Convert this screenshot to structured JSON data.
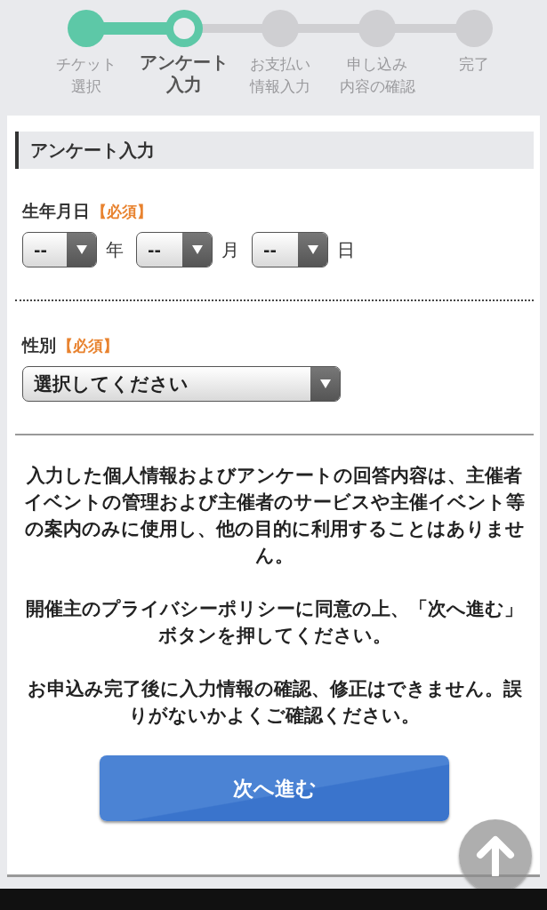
{
  "steps": [
    {
      "label_lines": [
        "チケット",
        "選択"
      ],
      "completed": true,
      "selected": false
    },
    {
      "label_lines": [
        "アンケート",
        "入力"
      ],
      "completed": false,
      "selected": true
    },
    {
      "label_lines": [
        "お支払い",
        "情報入力"
      ],
      "completed": false,
      "selected": false
    },
    {
      "label_lines": [
        "申し込み",
        "内容の確認"
      ],
      "completed": false,
      "selected": false
    },
    {
      "label_lines": [
        "完了"
      ],
      "completed": false,
      "selected": false
    }
  ],
  "section": {
    "title": "アンケート入力"
  },
  "fields": [
    {
      "kind": "date",
      "label": "生年月日",
      "required": "【必須】",
      "selects": [
        {
          "value": "--",
          "unit": "年"
        },
        {
          "value": "--",
          "unit": "月"
        },
        {
          "value": "--",
          "unit": "日"
        }
      ]
    },
    {
      "kind": "select",
      "label": "性別",
      "required": "【必須】",
      "value": "選択してください"
    }
  ],
  "notices": [
    "入力した個人情報およびアンケートの回答内容は、主催者イベントの管理および主催者のサービスや主催イベント等の案内のみに使用し、他の目的に利用することはありません。",
    "開催主のプライバシーポリシーに同意の上、「次へ進む」ボタンを押してください。",
    "お申込み完了後に入力情報の確認、修正はできません。誤りがないかよくご確認ください。"
  ],
  "next_button": "次へ進む"
}
